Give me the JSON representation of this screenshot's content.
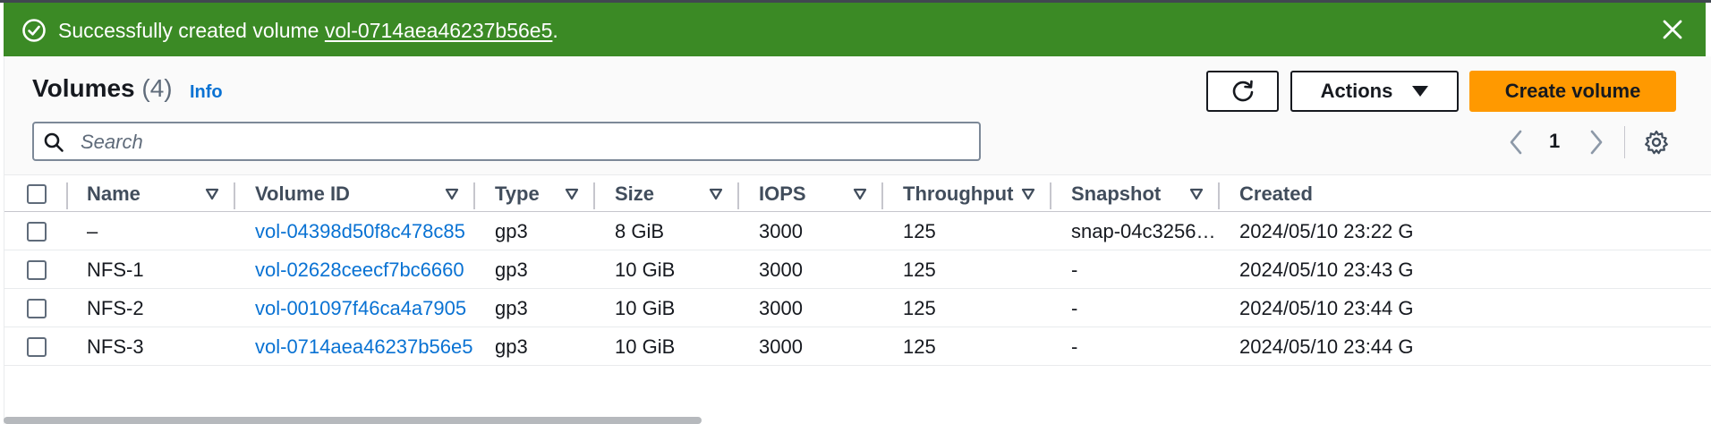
{
  "flash": {
    "message_prefix": "Successfully created volume ",
    "volume_link": "vol-0714aea46237b56e5",
    "message_suffix": ".",
    "background": "#3b8a25"
  },
  "header": {
    "title": "Volumes",
    "count": "(4)",
    "info_link": "Info"
  },
  "toolbar": {
    "refresh_icon": "refresh-icon",
    "actions_label": "Actions",
    "create_label": "Create volume",
    "create_color": "#ff9900"
  },
  "search": {
    "placeholder": "Search",
    "value": ""
  },
  "pagination": {
    "current_page": "1"
  },
  "table": {
    "columns": [
      "Name",
      "Volume ID",
      "Type",
      "Size",
      "IOPS",
      "Throughput",
      "Snapshot",
      "Created"
    ],
    "rows": [
      {
        "name": "–",
        "volume_id": "vol-04398d50f8c478c85",
        "type": "gp3",
        "size": "8 GiB",
        "iops": "3000",
        "throughput": "125",
        "snapshot": "snap-04c3256…",
        "created": "2024/05/10 23:22 G"
      },
      {
        "name": "NFS-1",
        "volume_id": "vol-02628ceecf7bc6660",
        "type": "gp3",
        "size": "10 GiB",
        "iops": "3000",
        "throughput": "125",
        "snapshot": "-",
        "created": "2024/05/10 23:43 G"
      },
      {
        "name": "NFS-2",
        "volume_id": "vol-001097f46ca4a7905",
        "type": "gp3",
        "size": "10 GiB",
        "iops": "3000",
        "throughput": "125",
        "snapshot": "-",
        "created": "2024/05/10 23:44 G"
      },
      {
        "name": "NFS-3",
        "volume_id": "vol-0714aea46237b56e5",
        "type": "gp3",
        "size": "10 GiB",
        "iops": "3000",
        "throughput": "125",
        "snapshot": "-",
        "created": "2024/05/10 23:44 G"
      }
    ]
  },
  "colors": {
    "link": "#0972d3",
    "header_bg": "#fafafa"
  }
}
